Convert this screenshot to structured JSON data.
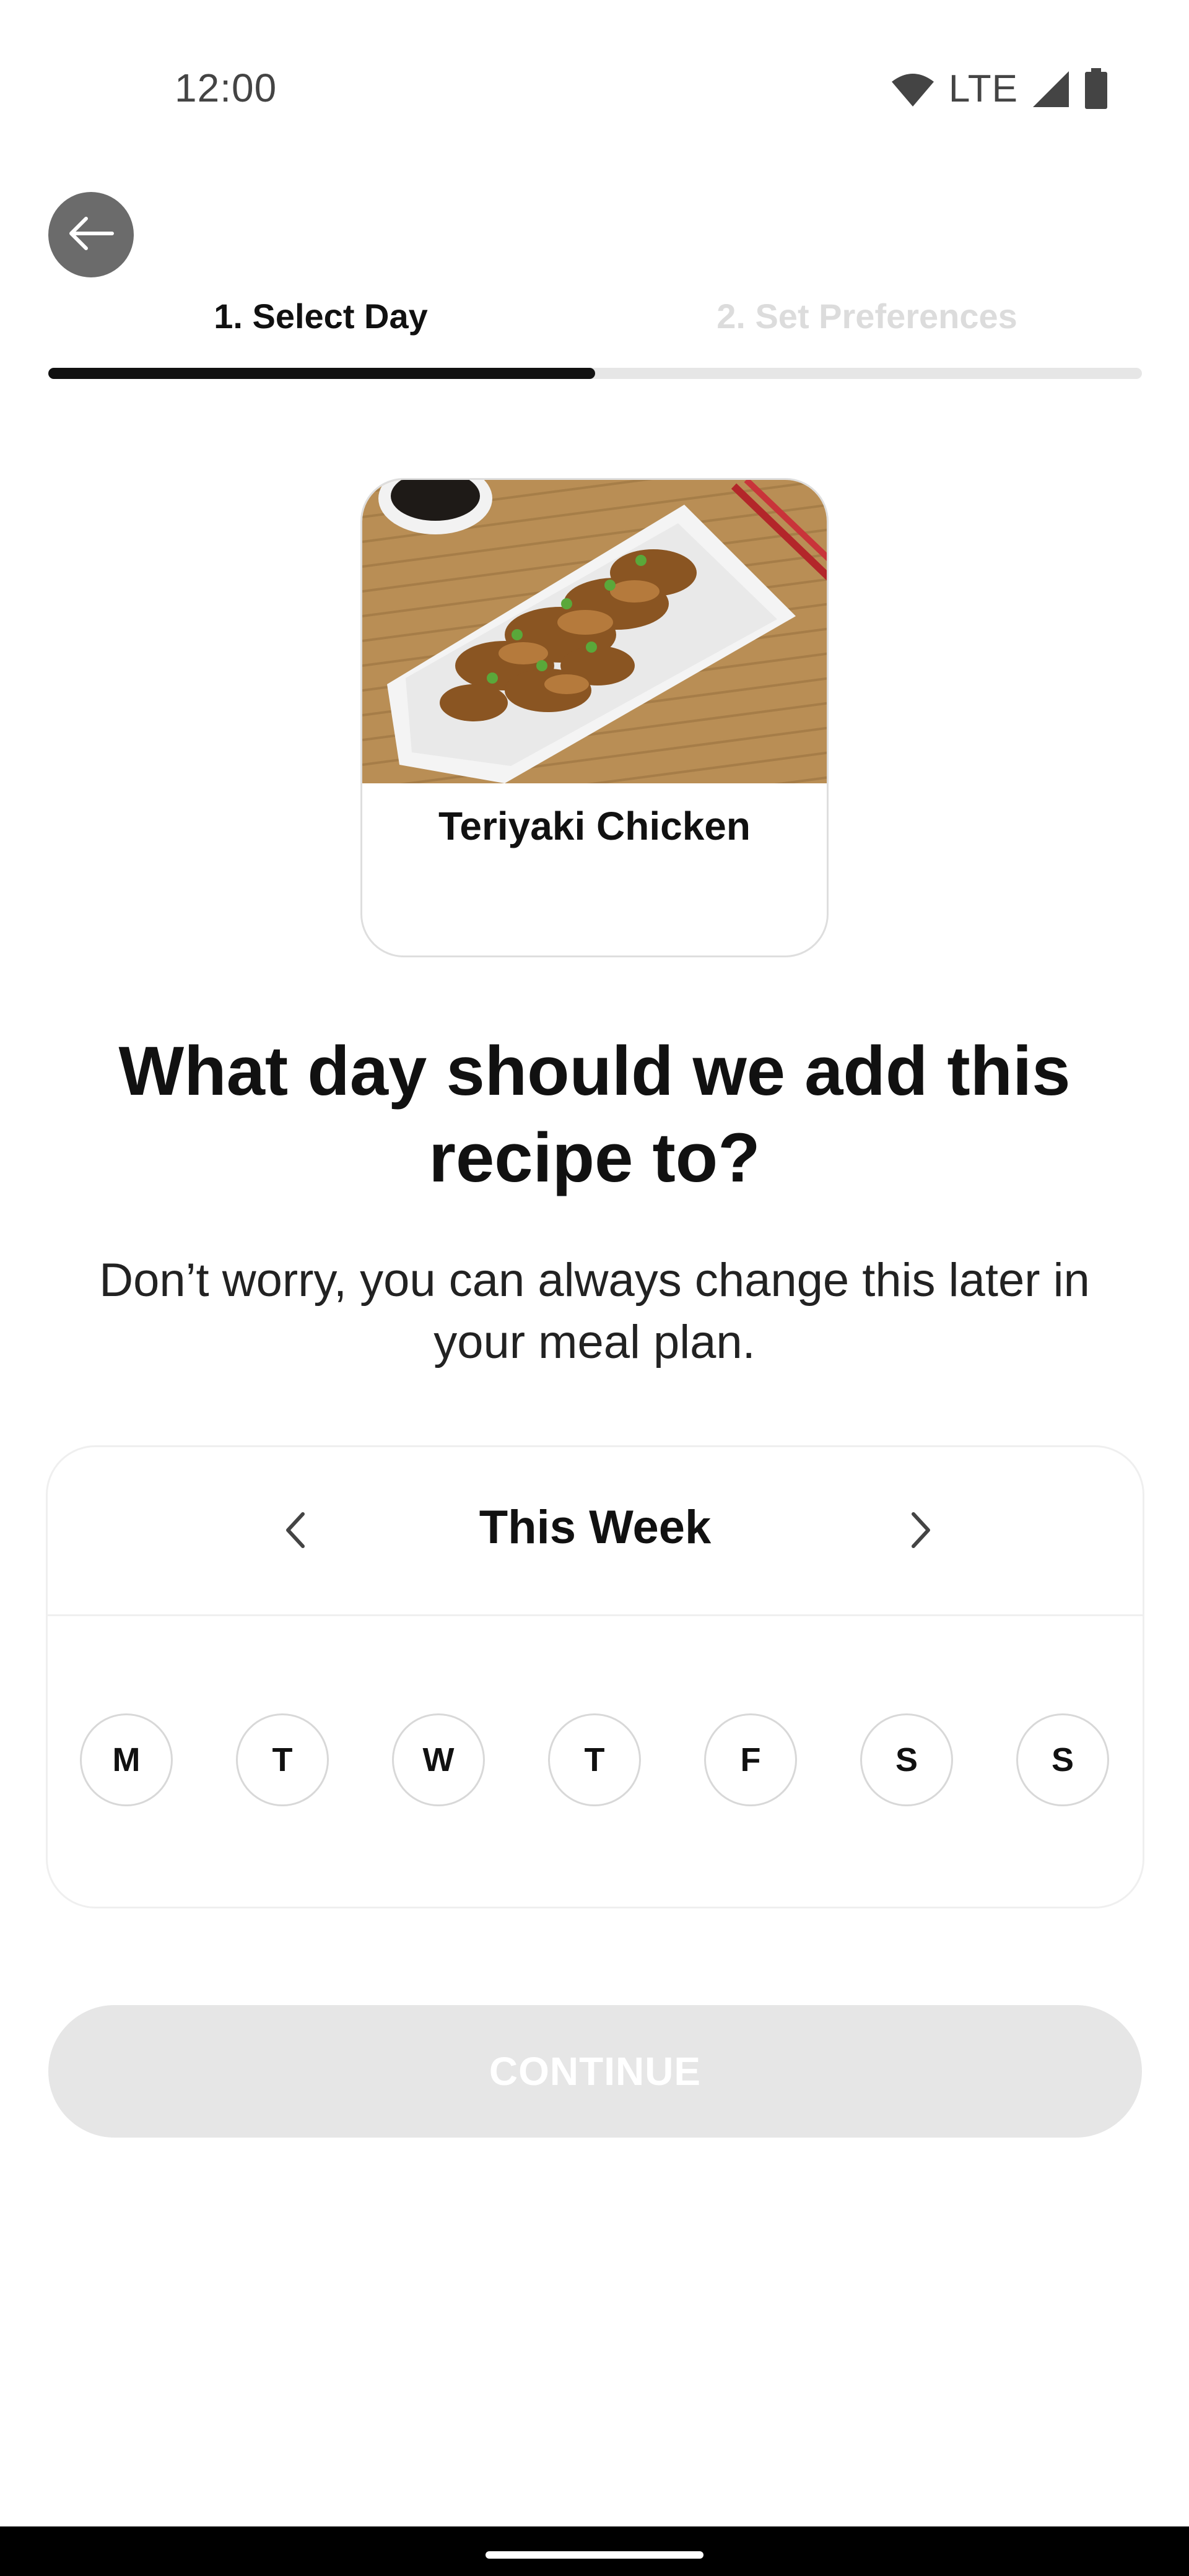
{
  "status_bar": {
    "time": "12:00",
    "network": "LTE",
    "icons": [
      "wifi-icon",
      "signal-icon",
      "battery-icon"
    ]
  },
  "header": {
    "back_icon": "arrow-left-icon",
    "steps": [
      {
        "label": "1. Select Day",
        "active": true
      },
      {
        "label": "2. Set Preferences",
        "active": false
      }
    ],
    "progress": 0.5
  },
  "recipe": {
    "name": "Teriyaki Chicken"
  },
  "question": {
    "title": "What day should we add this recipe to?",
    "subtitle": "Don’t worry, you can always change this later in your meal plan."
  },
  "week": {
    "title": "This Week",
    "prev_icon": "chevron-left-icon",
    "next_icon": "chevron-right-icon",
    "days": [
      "M",
      "T",
      "W",
      "T",
      "F",
      "S",
      "S"
    ]
  },
  "continue": {
    "label": "CONTINUE",
    "enabled": false
  },
  "colors": {
    "primary_text": "#111111",
    "inactive_step": "#dcdcdc",
    "progress_track": "#e6e6e6",
    "disabled_button": "#e6e6e6",
    "back_button": "#6b6b6b"
  }
}
